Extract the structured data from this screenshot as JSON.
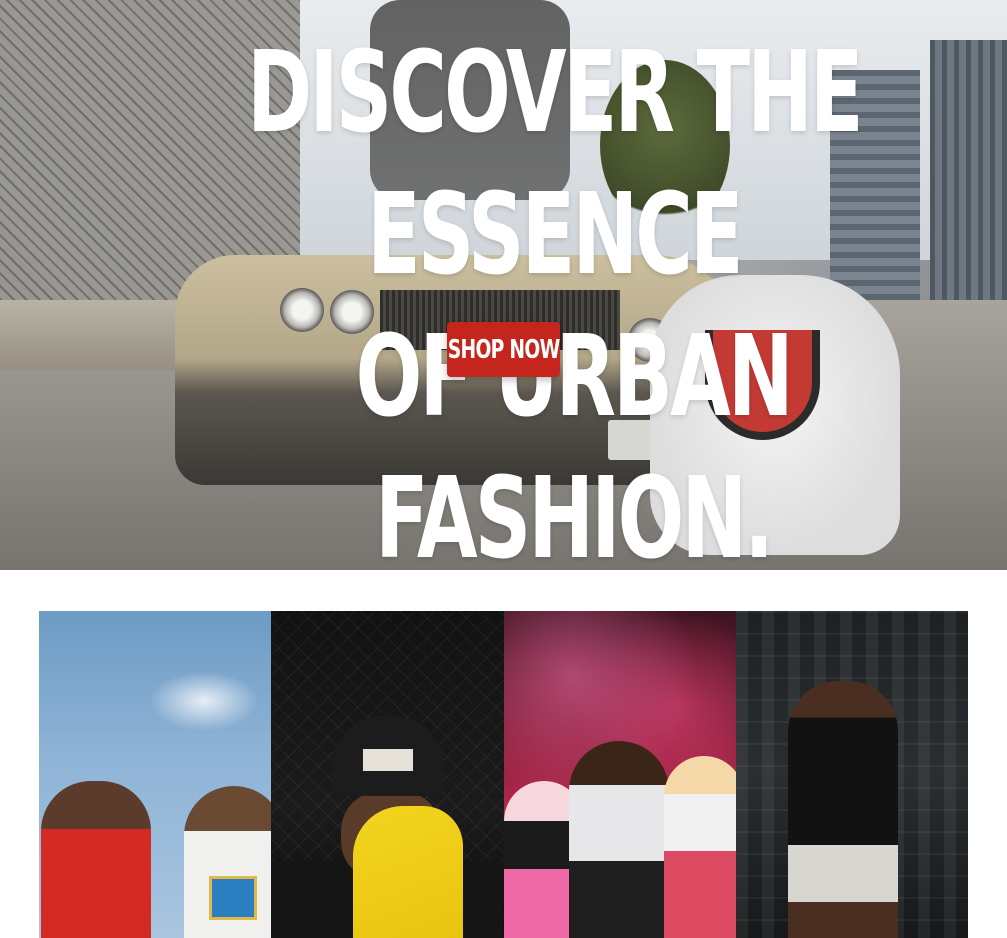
{
  "hero": {
    "title_line1": "DISCOVER THE ESSENCE",
    "title_line2": "OF URBAN FASHION.",
    "cta_label": "SHOP NOW",
    "cta_color": "#c4261d"
  },
  "gallery": {
    "items": [
      {
        "name": "gallery-card-1"
      },
      {
        "name": "gallery-card-2"
      },
      {
        "name": "gallery-card-3"
      },
      {
        "name": "gallery-card-4"
      }
    ]
  }
}
